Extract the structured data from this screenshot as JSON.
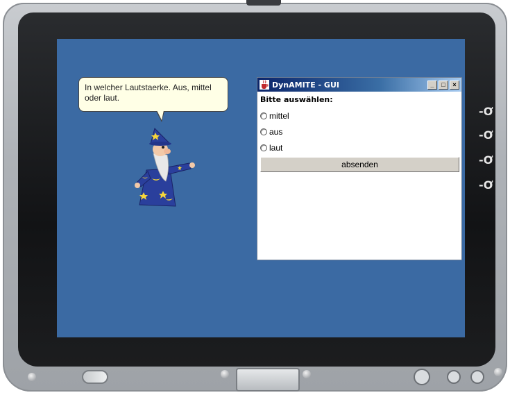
{
  "speech": {
    "text": "In welcher Lautstaerke. Aus, mittel oder laut."
  },
  "window": {
    "title": "DynAMITE - GUI",
    "prompt": "Bitte auswählen:",
    "options": [
      {
        "label": "mittel"
      },
      {
        "label": "aus"
      },
      {
        "label": "laut"
      }
    ],
    "submit_label": "absenden",
    "controls": {
      "minimize": "_",
      "maximize": "□",
      "close": "×"
    }
  },
  "side_indicators": [
    "-Ơ",
    "-Ơ",
    "-Ơ",
    "-Ơ"
  ],
  "colors": {
    "screen_background": "#3b6aa3",
    "titlebar": "#0a246a",
    "speech_bubble": "#ffffe6"
  },
  "icons": {
    "app": "java-cup-icon",
    "character": "wizard-character"
  }
}
